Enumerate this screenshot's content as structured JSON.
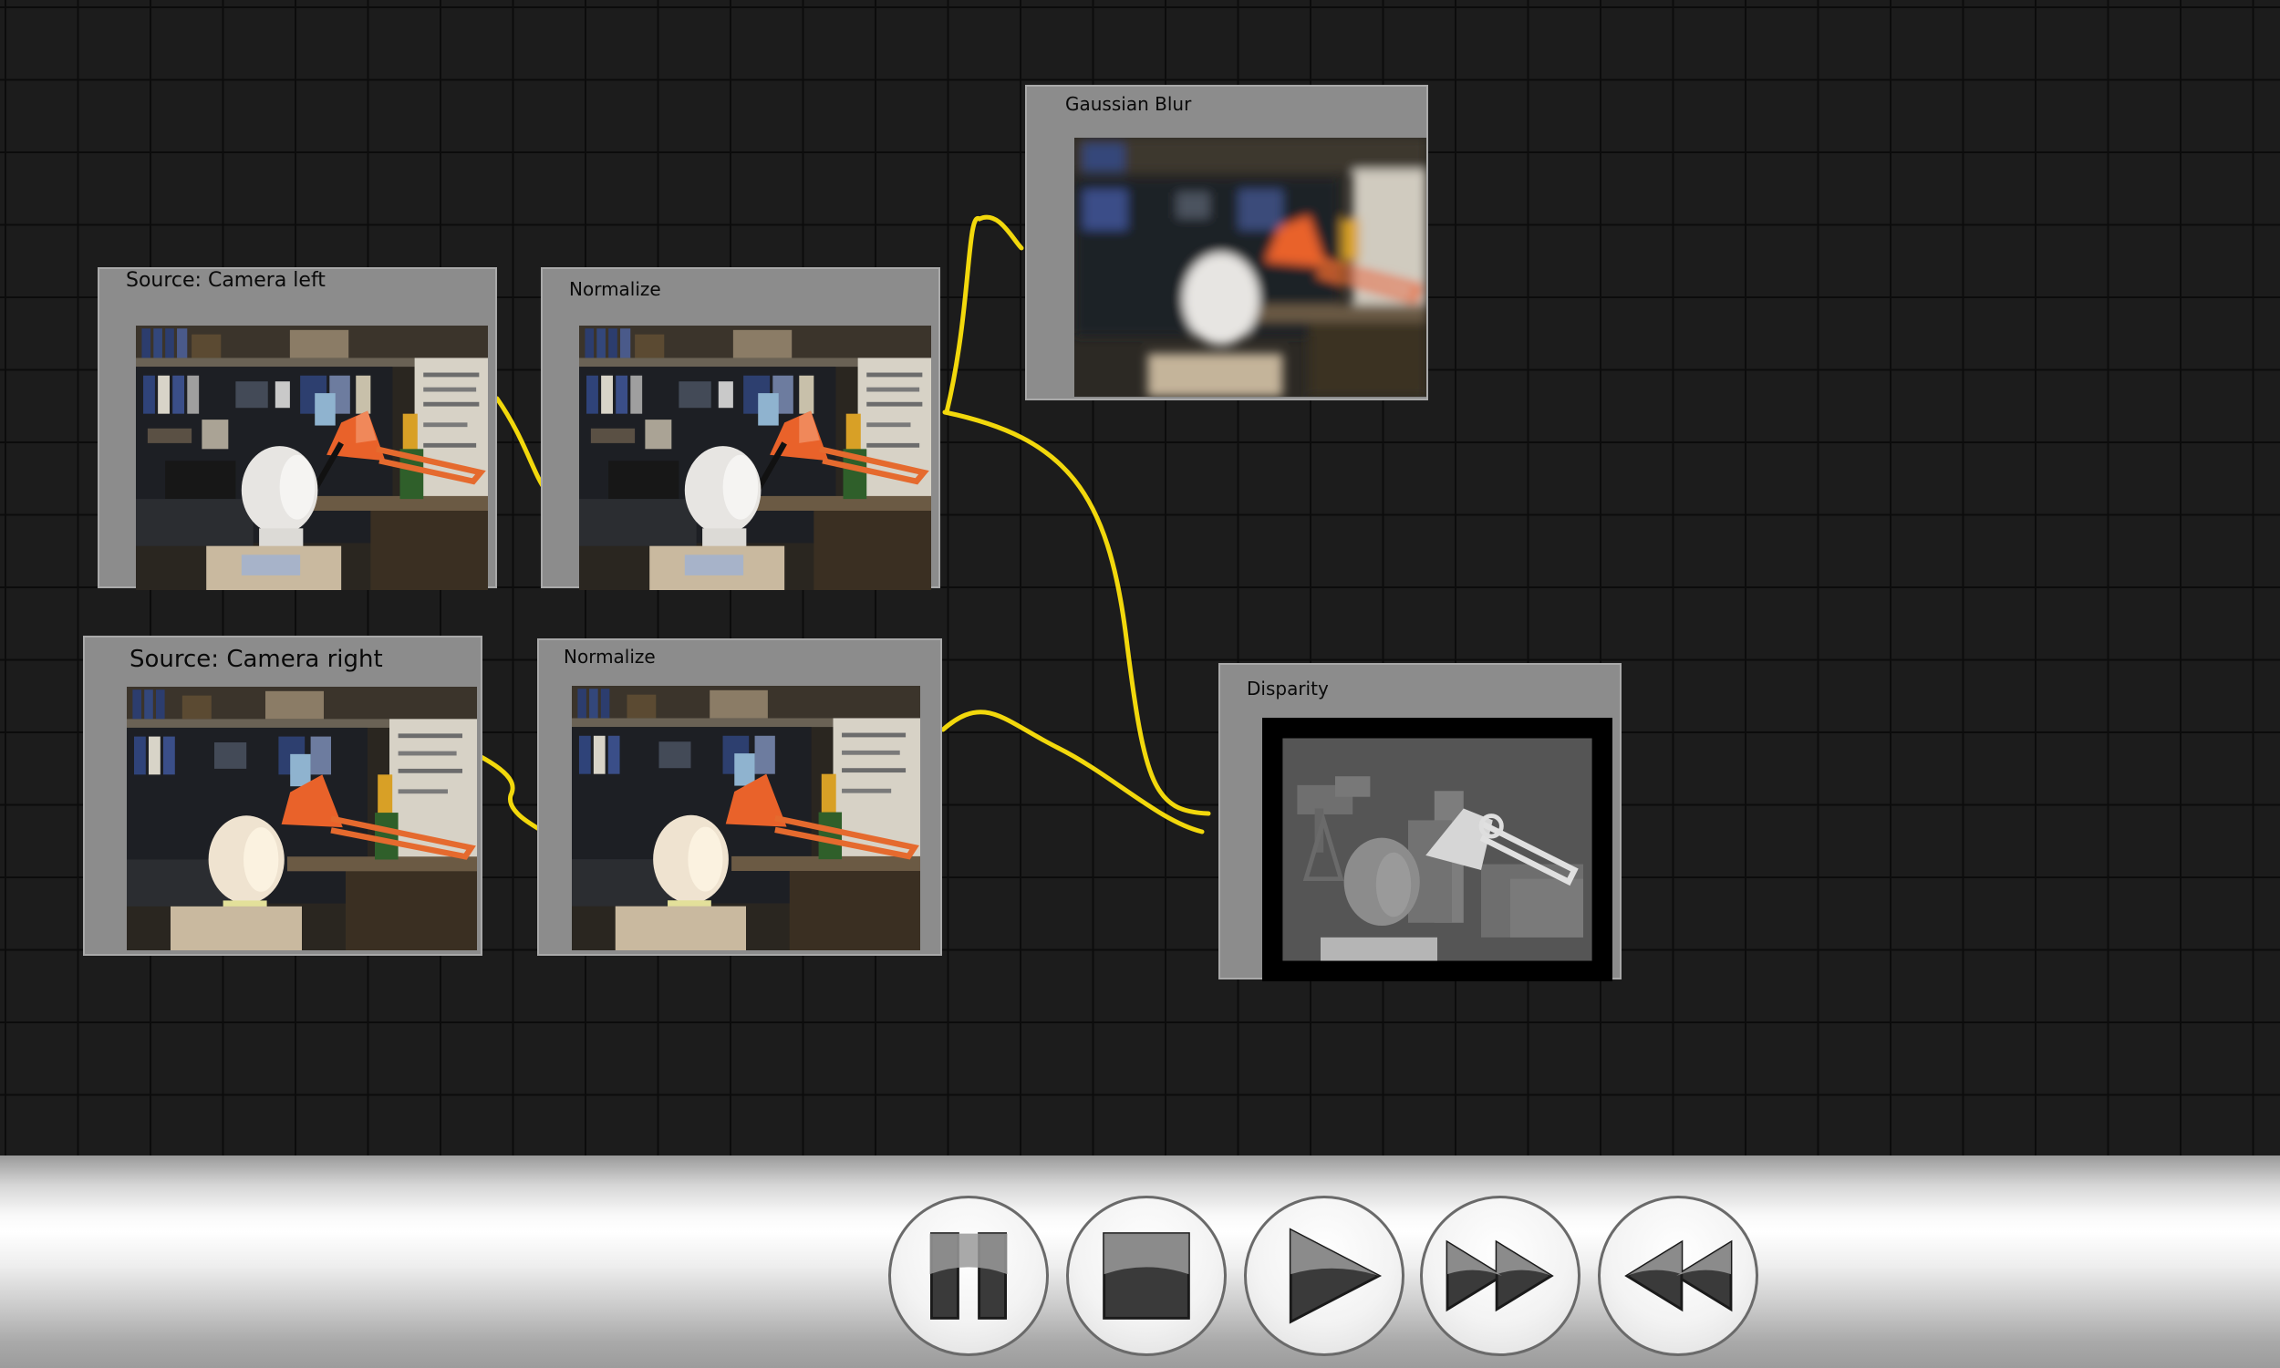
{
  "graph": {
    "nodes": [
      {
        "id": "source-left",
        "title": "Source: Camera left",
        "preview": "photo-left"
      },
      {
        "id": "normalize-left",
        "title": "Normalize",
        "preview": "photo-left"
      },
      {
        "id": "gaussian-blur",
        "title": "Gaussian Blur",
        "preview": "photo-blur"
      },
      {
        "id": "source-right",
        "title": "Source: Camera right",
        "preview": "photo-right"
      },
      {
        "id": "normalize-right",
        "title": "Normalize",
        "preview": "photo-right"
      },
      {
        "id": "disparity",
        "title": "Disparity",
        "preview": "disparity-map"
      }
    ],
    "connections": [
      {
        "from": "source-left",
        "to": "normalize-left"
      },
      {
        "from": "source-right",
        "to": "normalize-right"
      },
      {
        "from": "normalize-left",
        "to": "gaussian-blur"
      },
      {
        "from": "normalize-left",
        "to": "disparity"
      },
      {
        "from": "normalize-right",
        "to": "disparity"
      }
    ],
    "wire_color": "#f2d80c",
    "node_color": "#8c8c8c",
    "background_color": "#1c1c1c"
  },
  "transport": {
    "buttons": [
      {
        "name": "pause-button",
        "icon": "pause-icon"
      },
      {
        "name": "stop-button",
        "icon": "stop-icon"
      },
      {
        "name": "play-button",
        "icon": "play-icon"
      },
      {
        "name": "fast-forward-button",
        "icon": "fast-forward-icon"
      },
      {
        "name": "rewind-button",
        "icon": "rewind-icon"
      }
    ]
  }
}
